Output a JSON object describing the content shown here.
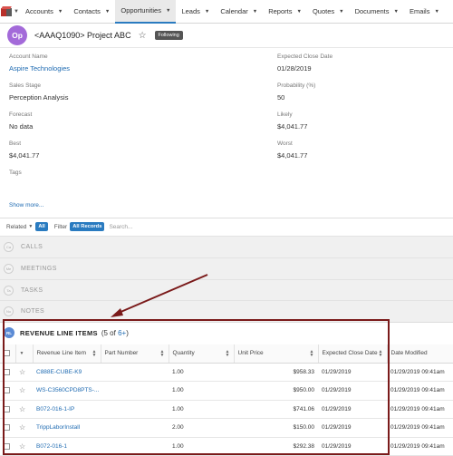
{
  "nav": {
    "items": [
      {
        "label": "Accounts"
      },
      {
        "label": "Contacts"
      },
      {
        "label": "Opportunities"
      },
      {
        "label": "Leads"
      },
      {
        "label": "Calendar"
      },
      {
        "label": "Reports"
      },
      {
        "label": "Quotes"
      },
      {
        "label": "Documents"
      },
      {
        "label": "Emails"
      }
    ]
  },
  "record": {
    "avatar": "Op",
    "title": "<AAAQ1090> Project ABC",
    "following": "Following"
  },
  "fields": {
    "account_name": {
      "label": "Account Name",
      "value": "Aspire Technologies"
    },
    "expected_close": {
      "label": "Expected Close Date",
      "value": "01/28/2019"
    },
    "sales_stage": {
      "label": "Sales Stage",
      "value": "Perception Analysis"
    },
    "probability": {
      "label": "Probability (%)",
      "value": "50"
    },
    "forecast": {
      "label": "Forecast",
      "value": "No data"
    },
    "likely": {
      "label": "Likely",
      "value": "$4,041.77"
    },
    "best": {
      "label": "Best",
      "value": "$4,041.77"
    },
    "worst": {
      "label": "Worst",
      "value": "$4,041.77"
    },
    "tags": {
      "label": "Tags"
    }
  },
  "show_more": "Show more...",
  "filter_bar": {
    "related": "Related",
    "all": "All",
    "filter": "Filter",
    "all_records": "All Records",
    "search_placeholder": "Search..."
  },
  "subpanels": [
    {
      "icon": "Ca",
      "label": "CALLS"
    },
    {
      "icon": "Me",
      "label": "MEETINGS"
    },
    {
      "icon": "Ta",
      "label": "TASKS"
    },
    {
      "icon": "No",
      "label": "NOTES"
    }
  ],
  "rli": {
    "icon": "RL",
    "title": "REVENUE LINE ITEMS",
    "count_prefix": "(5 of ",
    "count_link": "6+",
    "count_suffix": ")",
    "columns": [
      "Revenue Line Item",
      "Part Number",
      "Quantity",
      "Unit Price",
      "Expected Close Date",
      "Date Modified"
    ],
    "rows": [
      {
        "name": "C888E-CUBE-K9",
        "part": "",
        "qty": "1.00",
        "price": "$958.33",
        "close": "01/29/2019",
        "modified": "01/29/2019 09:41am"
      },
      {
        "name": "WS-C3560CPD8PTS-...",
        "part": "",
        "qty": "1.00",
        "price": "$950.00",
        "close": "01/29/2019",
        "modified": "01/29/2019 09:41am"
      },
      {
        "name": "B072-016-1-IP",
        "part": "",
        "qty": "1.00",
        "price": "$741.06",
        "close": "01/29/2019",
        "modified": "01/29/2019 09:41am"
      },
      {
        "name": "TrippLaborInstall",
        "part": "",
        "qty": "2.00",
        "price": "$150.00",
        "close": "01/29/2019",
        "modified": "01/29/2019 09:41am"
      },
      {
        "name": "B072-016-1",
        "part": "",
        "qty": "1.00",
        "price": "$292.38",
        "close": "01/29/2019",
        "modified": "01/29/2019 09:41am"
      }
    ]
  },
  "colors": {
    "accent": "#2a7bc0",
    "link": "#1f6bb2",
    "avatar": "#a36ad9",
    "callout": "#7a1a1a"
  }
}
